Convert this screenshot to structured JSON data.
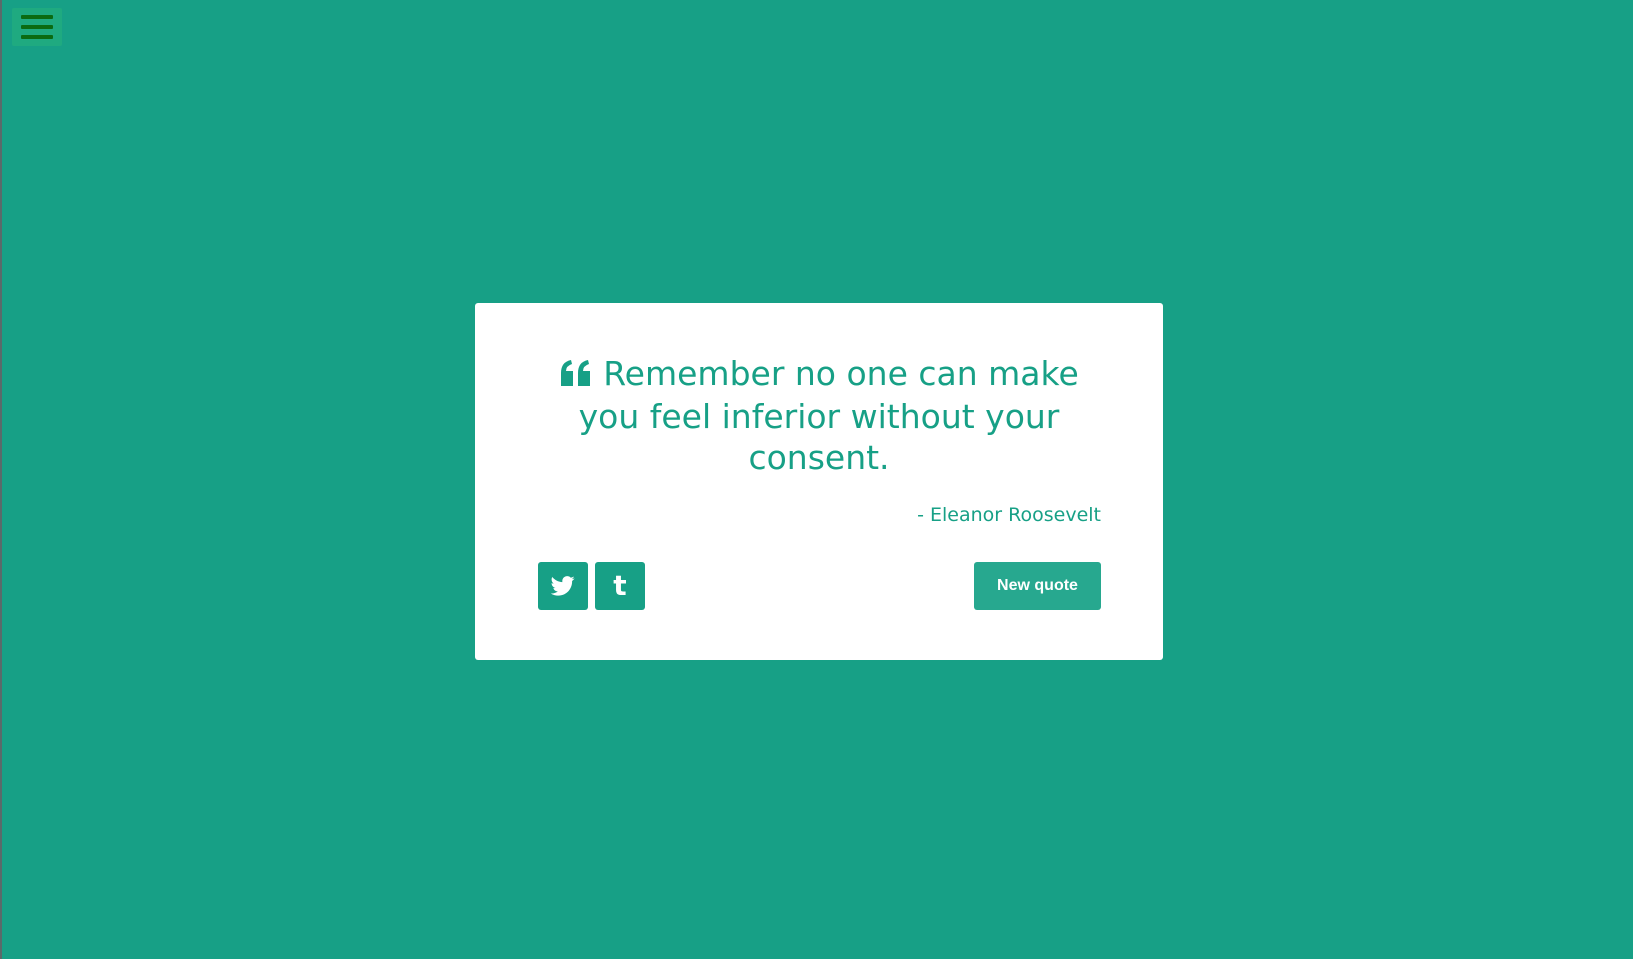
{
  "menu": {
    "icon": "hamburger-menu-icon",
    "icon_color": "#0b6b12"
  },
  "quote": {
    "icon": "quote-left-icon",
    "text": "Remember no one can make you feel inferior without your consent.",
    "author": "- Eleanor Roosevelt"
  },
  "actions": {
    "twitter_icon": "twitter-icon",
    "tumblr_icon": "tumblr-icon",
    "tumblr_glyph": "t",
    "new_quote_label": "New quote"
  },
  "colors": {
    "background": "#17a086",
    "card": "#ffffff",
    "accent": "#17a086",
    "button_text": "#ffffff"
  }
}
